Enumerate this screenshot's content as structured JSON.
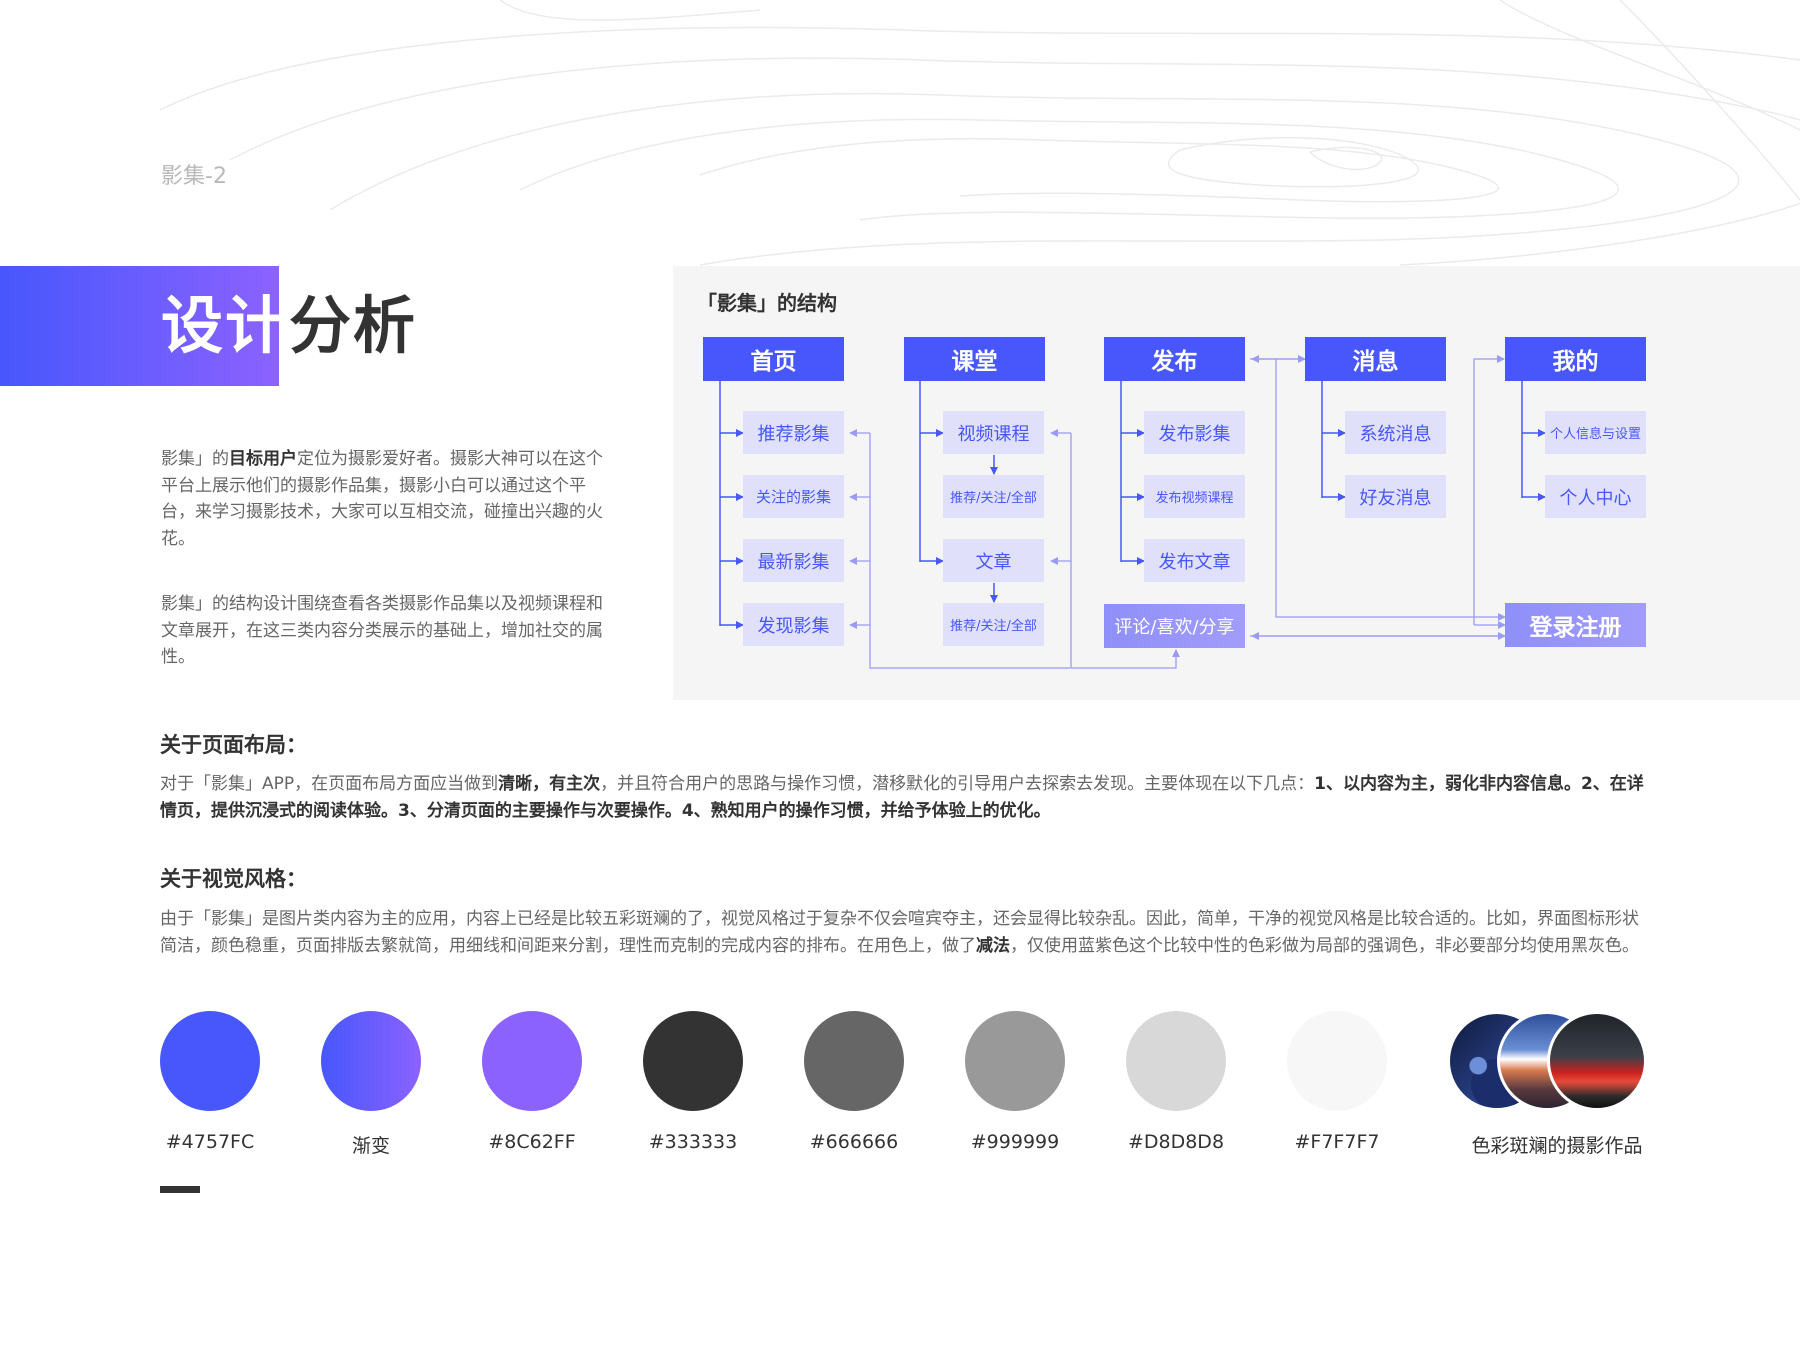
{
  "page": {
    "label": "影集-2",
    "title_highlight": "设计",
    "title_rest": "分析"
  },
  "intro": {
    "p1_prefix": "影集」的",
    "p1_bold": "目标用户",
    "p1_suffix": "定位为摄影爱好者。摄影大神可以在这个平台上展示他们的摄影作品集，摄影小白可以通过这个平台，来学习摄影技术，大家可以互相交流，碰撞出兴趣的火花。",
    "p2": "影集」的结构设计围绕查看各类摄影作品集以及视频课程和文章展开，在这三类内容分类展示的基础上，增加社交的属性。"
  },
  "diagram": {
    "title": "「影集」的结构",
    "nodes": {
      "home": "首页",
      "recommended": "推荐影集",
      "followed": "关注的影集",
      "latest": "最新影集",
      "discover": "发现影集",
      "classroom": "课堂",
      "video_courses": "视频课程",
      "video_filter": "推荐/关注/全部",
      "articles": "文章",
      "article_filter": "推荐/关注/全部",
      "publish": "发布",
      "publish_album": "发布影集",
      "publish_video": "发布视频课程",
      "publish_article": "发布文章",
      "social": "评论/喜欢/分享",
      "messages": "消息",
      "system_msg": "系统消息",
      "friend_msg": "好友消息",
      "mine": "我的",
      "profile_settings": "个人信息与设置",
      "personal_center": "个人中心",
      "login": "登录注册"
    }
  },
  "layout_section": {
    "title": "关于页面布局：",
    "text_1": "对于「影集」APP，在页面布局方面应当做到",
    "bold_1": "清晰，有主次",
    "text_2": "，并且符合用户的思路与操作习惯，潜移默化的引导用户去探索去发现。主要体现在以下几点：",
    "bold_2": "1、以内容为主，弱化非内容信息。2、在详情页，提供沉浸式的阅读体验。3、分清页面的主要操作与次要操作。4、熟知用户的操作习惯，并给予体验上的优化。"
  },
  "style_section": {
    "title": "关于视觉风格：",
    "text_1": "由于「影集」是图片类内容为主的应用，内容上已经是比较五彩斑斓的了，视觉风格过于复杂不仅会喧宾夺主，还会显得比较杂乱。因此，简单，干净的视觉风格是比较合适的。比如，界面图标形状简洁，颜色稳重，页面排版去繁就简，用细线和间距来分割，理性而克制的完成内容的排布。在用色上，做了",
    "bold_1": "减法",
    "text_2": "，仅使用蓝紫色这个比较中性的色彩做为局部的强调色，非必要部分均使用黑灰色。"
  },
  "palette": {
    "swatches": [
      {
        "label": "#4757FC",
        "color": "#4757FC"
      },
      {
        "label": "渐变",
        "gradient": [
          "#4757FC",
          "#8C62FF"
        ]
      },
      {
        "label": "#8C62FF",
        "color": "#8C62FF"
      },
      {
        "label": "#333333",
        "color": "#333333"
      },
      {
        "label": "#666666",
        "color": "#666666"
      },
      {
        "label": "#999999",
        "color": "#999999"
      },
      {
        "label": "#D8D8D8",
        "color": "#D8D8D8"
      },
      {
        "label": "#F7F7F7",
        "color": "#F7F7F7"
      }
    ],
    "photos_label": "色彩斑斓的摄影作品"
  },
  "colors": {
    "accent_blue": "#4757FC",
    "accent_purple": "#8C62FF",
    "text_dark": "#333333",
    "text_mid": "#666666",
    "panel_bg": "#f5f5f5",
    "child_bg": "#e0e0fb"
  }
}
